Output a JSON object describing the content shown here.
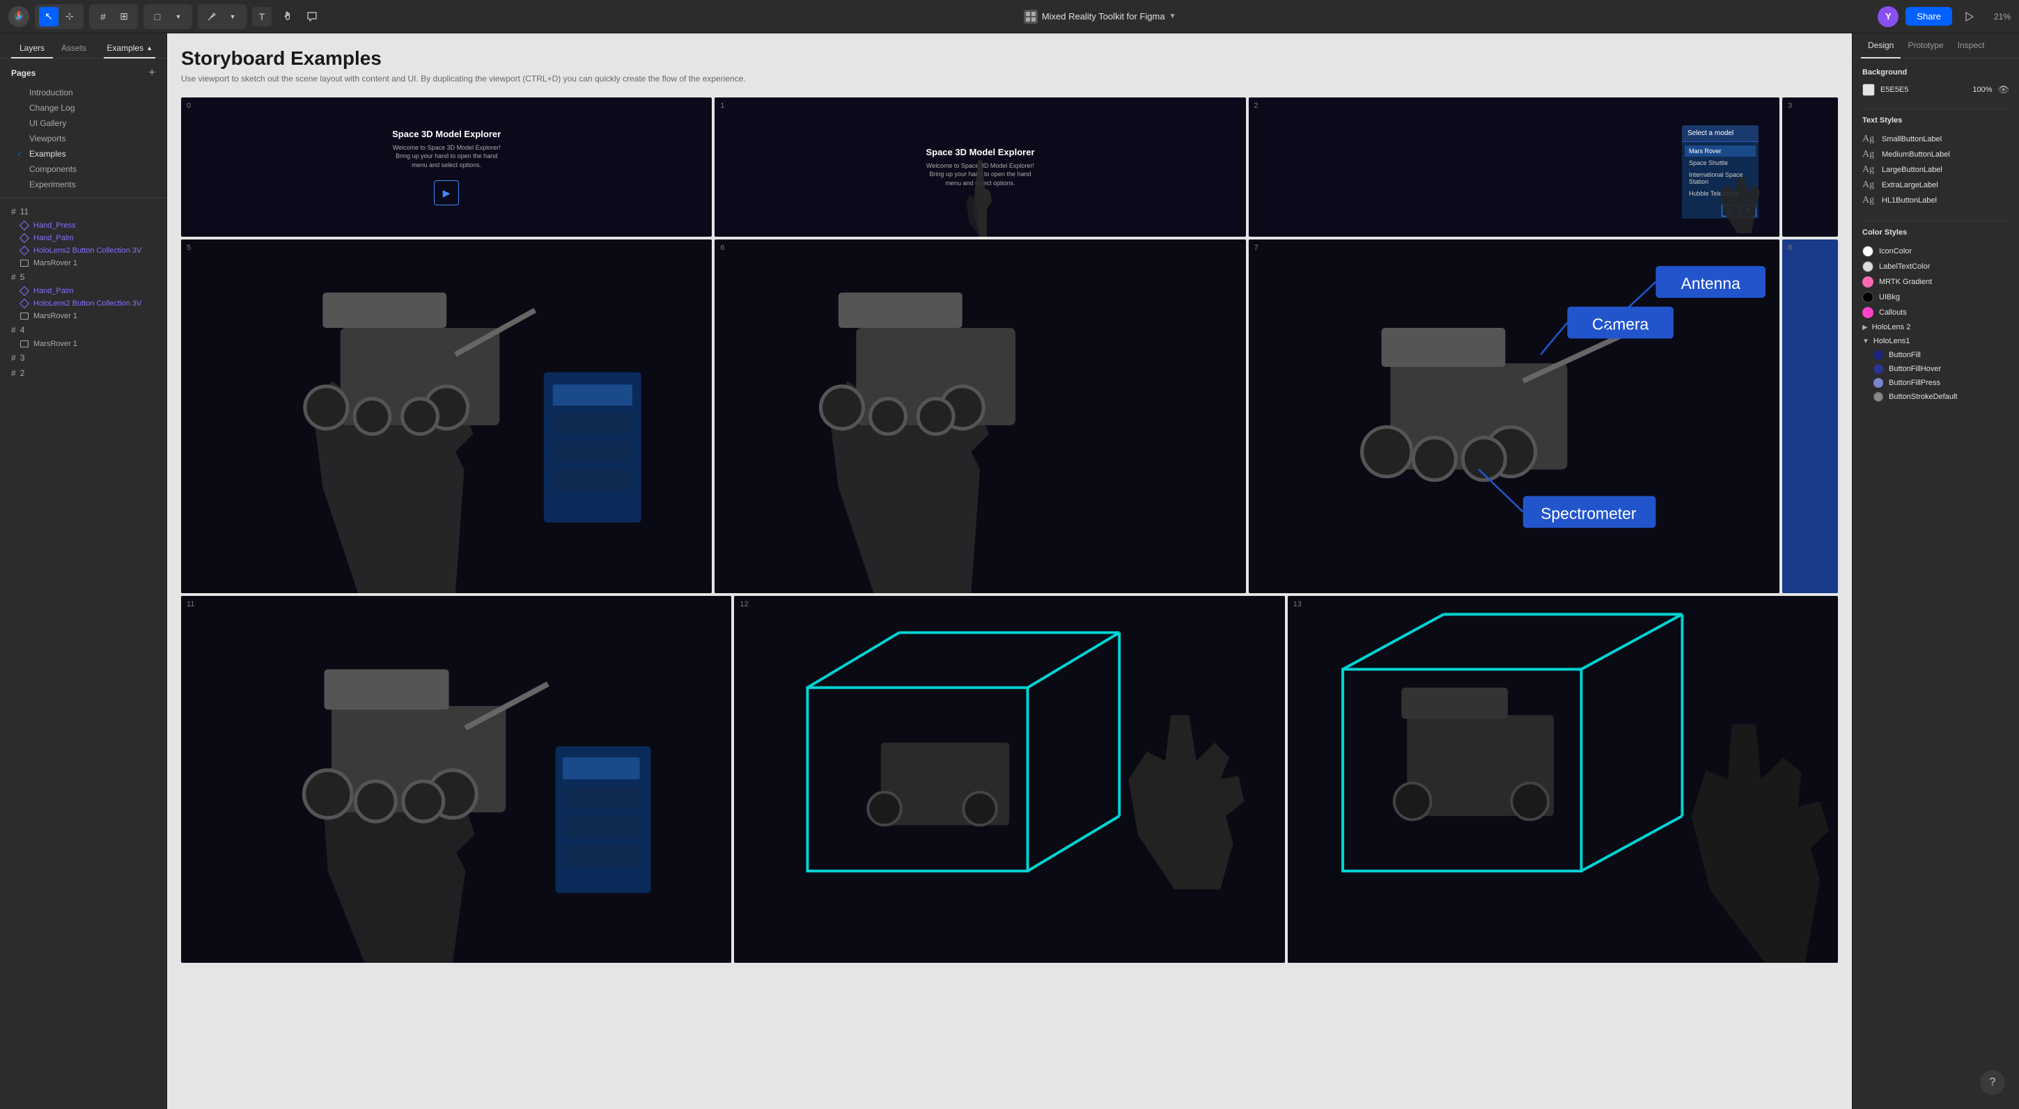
{
  "app": {
    "title": "Mixed Reality Toolkit for Figma",
    "zoom": "21%",
    "avatar_initial": "Y"
  },
  "toolbar": {
    "share_label": "Share",
    "tools": [
      {
        "name": "move",
        "icon": "↖",
        "active": false
      },
      {
        "name": "frame",
        "icon": "⊞",
        "active": false
      },
      {
        "name": "shape",
        "icon": "□",
        "active": false
      },
      {
        "name": "pen",
        "icon": "✏",
        "active": false
      },
      {
        "name": "text",
        "icon": "T",
        "active": false
      },
      {
        "name": "hand",
        "icon": "✋",
        "active": false
      },
      {
        "name": "comment",
        "icon": "💬",
        "active": false
      }
    ]
  },
  "left_sidebar": {
    "tabs": [
      "Layers",
      "Assets",
      "Examples"
    ],
    "active_tab": "Layers",
    "pages": {
      "title": "Pages",
      "items": [
        {
          "name": "Introduction",
          "active": false
        },
        {
          "name": "Change Log",
          "active": false
        },
        {
          "name": "UI Gallery",
          "active": false
        },
        {
          "name": "Viewports",
          "active": false
        },
        {
          "name": "Examples",
          "active": true
        },
        {
          "name": "Components",
          "active": false
        },
        {
          "name": "Experiments",
          "active": false
        }
      ]
    },
    "layer_groups": [
      {
        "id": "11",
        "items": [
          {
            "name": "Hand_Press",
            "type": "component"
          },
          {
            "name": "Hand_Palm",
            "type": "component"
          },
          {
            "name": "HoloLens2 Button Collection 3V",
            "type": "component"
          },
          {
            "name": "MarsRover 1",
            "type": "image"
          }
        ]
      },
      {
        "id": "5",
        "items": [
          {
            "name": "Hand_Palm",
            "type": "component"
          },
          {
            "name": "HoloLens2 Button Collection 3V",
            "type": "component"
          },
          {
            "name": "MarsRover 1",
            "type": "image"
          }
        ]
      },
      {
        "id": "4",
        "items": [
          {
            "name": "MarsRover 1",
            "type": "image"
          }
        ]
      },
      {
        "id": "3",
        "items": []
      },
      {
        "id": "2",
        "items": []
      }
    ]
  },
  "canvas": {
    "page_title": "Storyboard Examples",
    "page_description": "Use viewport to sketch out the scene layout with content and UI. By duplicating the viewport (CTRL+D) you can quickly create the flow of the experience.",
    "cells": [
      {
        "number": "0",
        "type": "intro_screen",
        "title": "Space 3D Model Explorer",
        "subtitle": "Welcome to Space 3D Model Explorer! Bring up your hand to open the hand menu and select options."
      },
      {
        "number": "1",
        "type": "hand_point",
        "title": "Space 3D Model Explorer",
        "subtitle": "Welcome to Space 3D Model Explorer! Bring up your hand to open the hand menu and select options."
      },
      {
        "number": "2",
        "type": "menu_select",
        "title": "Select a model"
      },
      {
        "number": "3",
        "type": "overflow"
      },
      {
        "number": "5",
        "type": "rover_hand",
        "title": ""
      },
      {
        "number": "6",
        "type": "rover_hold",
        "title": ""
      },
      {
        "number": "7",
        "type": "rover_callout",
        "labels": [
          "Camera",
          "Antenna",
          "Spectrometer"
        ]
      },
      {
        "number": "8",
        "type": "overflow"
      },
      {
        "number": "11",
        "type": "rover_hold2"
      },
      {
        "number": "12",
        "type": "wireframe_grab"
      },
      {
        "number": "13",
        "type": "wireframe_hand"
      }
    ]
  },
  "right_sidebar": {
    "tabs": [
      "Design",
      "Prototype",
      "Inspect"
    ],
    "active_tab": "Design",
    "background": {
      "label": "Background",
      "color": "E5E5E5",
      "opacity": "100%"
    },
    "text_styles": {
      "title": "Text Styles",
      "items": [
        {
          "name": "SmallButtonLabel"
        },
        {
          "name": "MediumButtonLabel"
        },
        {
          "name": "LargeButtonLabel"
        },
        {
          "name": "ExtraLargeLabel"
        },
        {
          "name": "HL1ButtonLabel"
        }
      ]
    },
    "color_styles": {
      "title": "Color Styles",
      "top_items": [
        {
          "name": "IconColor",
          "color_class": "white"
        },
        {
          "name": "LabelTextColor",
          "color_class": "light-gray"
        },
        {
          "name": "MRTK Gradient",
          "color_class": "pink"
        },
        {
          "name": "UIBkg",
          "color_class": "black"
        },
        {
          "name": "Callouts",
          "color_class": "magenta"
        }
      ],
      "groups": [
        {
          "name": "HoloLens 2",
          "expanded": false,
          "items": []
        },
        {
          "name": "HoloLens1",
          "expanded": true,
          "items": [
            {
              "name": "ButtonFill",
              "color": "#1a237e"
            },
            {
              "name": "ButtonFillHover",
              "color": "#283593"
            },
            {
              "name": "ButtonFillPress",
              "color": "#7986cb"
            },
            {
              "name": "ButtonStrokeDefault",
              "color": "#555"
            }
          ]
        }
      ]
    }
  }
}
